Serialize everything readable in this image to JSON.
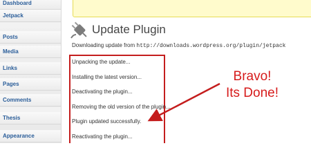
{
  "sidebar": {
    "items": [
      {
        "label": "Dashboard"
      },
      {
        "label": "Jetpack"
      },
      {
        "label": "Posts"
      },
      {
        "label": "Media"
      },
      {
        "label": "Links"
      },
      {
        "label": "Pages"
      },
      {
        "label": "Comments"
      },
      {
        "label": "Thesis"
      },
      {
        "label": "Appearance"
      }
    ]
  },
  "main": {
    "title": "Update Plugin",
    "download_prefix": "Downloading update from ",
    "download_url": "http://downloads.wordpress.org/plugin/jetpack",
    "log_lines": [
      "Unpacking the update...",
      "Installing the latest version...",
      "Deactivating the plugin...",
      "Removing the old version of the plugin...",
      "Plugin updated successfully.",
      "Reactivating the plugin..."
    ]
  },
  "annotation": {
    "line1": "Bravo!",
    "line2": "Its Done!",
    "color": "#d61b1b"
  },
  "colors": {
    "highlight_border": "#c41d1d",
    "notice_bg": "#fffbcc",
    "link": "#2a5d99"
  },
  "icons": {
    "title_icon": "plug-icon",
    "arrow": "arrow-icon"
  }
}
